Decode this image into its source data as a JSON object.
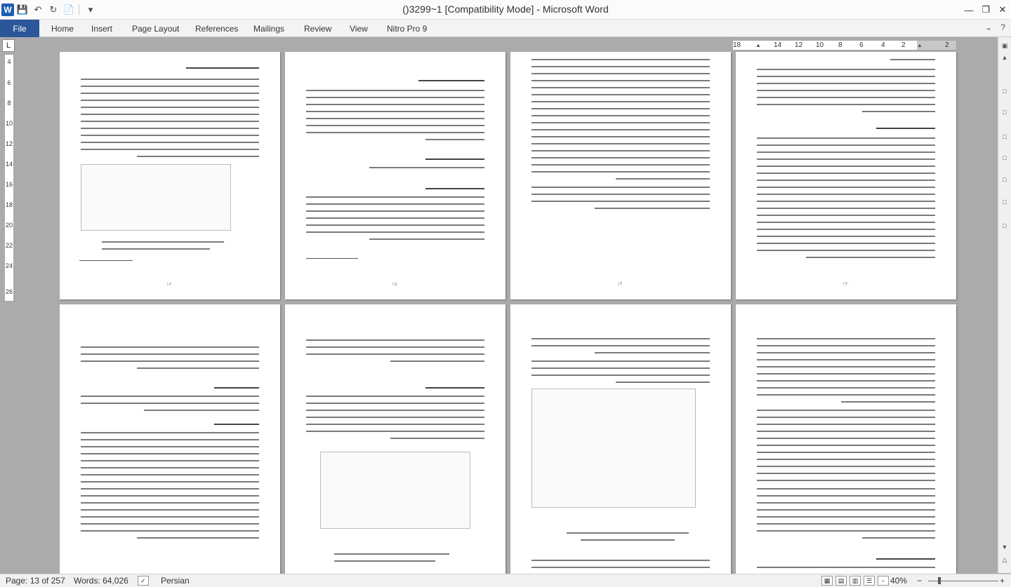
{
  "window": {
    "title": "()3299~1 [Compatibility Mode]  -  Microsoft Word",
    "app_logo": "W",
    "controls": [
      "minimize-icon",
      "restore-icon",
      "close-icon"
    ]
  },
  "quick_access": {
    "icons": [
      "save-icon",
      "undo-icon",
      "redo-icon",
      "new-document-icon",
      "customize-icon"
    ]
  },
  "ribbon": {
    "file_label": "File",
    "tabs": [
      "Home",
      "Insert",
      "Page Layout",
      "References",
      "Mailings",
      "Review",
      "View",
      "Nitro Pro 9"
    ]
  },
  "ruler": {
    "corner_symbol": "L",
    "horizontal_ticks": [
      "18",
      "14",
      "12",
      "10",
      "8",
      "6",
      "4",
      "2",
      "2"
    ],
    "vertical_ticks": [
      "4",
      "6",
      "8",
      "10",
      "12",
      "14",
      "16",
      "18",
      "20",
      "22",
      "24",
      "26"
    ]
  },
  "document": {
    "page_numbers_row1": [
      "۱۶",
      "۱۵",
      "۱۴",
      "۱۳"
    ],
    "page_numbers_row2": [
      "",
      "",
      "",
      ""
    ]
  },
  "status": {
    "page": "Page: 13 of 257",
    "words": "Words: 64,026",
    "language": "Persian",
    "zoom": "40%",
    "zoom_minus": "−",
    "zoom_plus": "+"
  }
}
